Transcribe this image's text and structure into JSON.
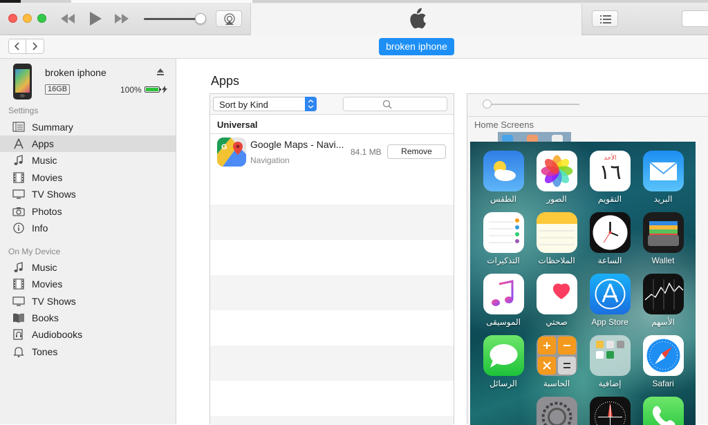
{
  "toolbar": {
    "device_button": "broken iphone"
  },
  "device": {
    "name": "broken iphone",
    "capacity": "16GB",
    "battery_percent": "100%",
    "battery_level": 1.0
  },
  "sidebar": {
    "settings_header": "Settings",
    "settings_items": [
      {
        "label": "Summary",
        "icon": "summary-icon"
      },
      {
        "label": "Apps",
        "icon": "apps-icon"
      },
      {
        "label": "Music",
        "icon": "music-note-icon"
      },
      {
        "label": "Movies",
        "icon": "film-icon"
      },
      {
        "label": "TV Shows",
        "icon": "tv-icon"
      },
      {
        "label": "Photos",
        "icon": "camera-icon"
      },
      {
        "label": "Info",
        "icon": "info-icon"
      }
    ],
    "device_header": "On My Device",
    "device_items": [
      {
        "label": "Music",
        "icon": "music-note-icon"
      },
      {
        "label": "Movies",
        "icon": "film-icon"
      },
      {
        "label": "TV Shows",
        "icon": "tv-icon"
      },
      {
        "label": "Books",
        "icon": "book-icon"
      },
      {
        "label": "Audiobooks",
        "icon": "audiobook-icon"
      },
      {
        "label": "Tones",
        "icon": "bell-icon"
      }
    ]
  },
  "main": {
    "title": "Apps",
    "sort_label": "Sort by Kind",
    "group": "Universal",
    "apps": [
      {
        "name": "Google Maps - Navi...",
        "category": "Navigation",
        "size": "84.1 MB",
        "action": "Remove"
      }
    ],
    "home_screens_label": "Home Screens",
    "home_screen_icons": [
      {
        "label": "الطقس",
        "icon": "weather-icon"
      },
      {
        "label": "الصور",
        "icon": "photos-icon"
      },
      {
        "label": "التقويم",
        "icon": "calendar-icon",
        "month": "الأحد",
        "day": "١٦"
      },
      {
        "label": "البريد",
        "icon": "mail-icon"
      },
      {
        "label": "التذكيرات",
        "icon": "reminders-icon"
      },
      {
        "label": "الملاحظات",
        "icon": "notes-icon"
      },
      {
        "label": "الساعة",
        "icon": "clock-icon"
      },
      {
        "label": "Wallet",
        "icon": "wallet-icon"
      },
      {
        "label": "الموسيقى",
        "icon": "music-app-icon"
      },
      {
        "label": "صحتي",
        "icon": "health-icon"
      },
      {
        "label": "App Store",
        "icon": "app-store-icon"
      },
      {
        "label": "الأسهم",
        "icon": "stocks-icon"
      },
      {
        "label": "الرسائل",
        "icon": "messages-icon"
      },
      {
        "label": "الحاسبة",
        "icon": "calculator-icon"
      },
      {
        "label": "إضافية",
        "icon": "folder-icon"
      },
      {
        "label": "Safari",
        "icon": "safari-icon"
      }
    ]
  },
  "colors": {
    "accent": "#1e90f5",
    "selected_row": "#dcdcdc",
    "battery": "#2bc23a"
  }
}
